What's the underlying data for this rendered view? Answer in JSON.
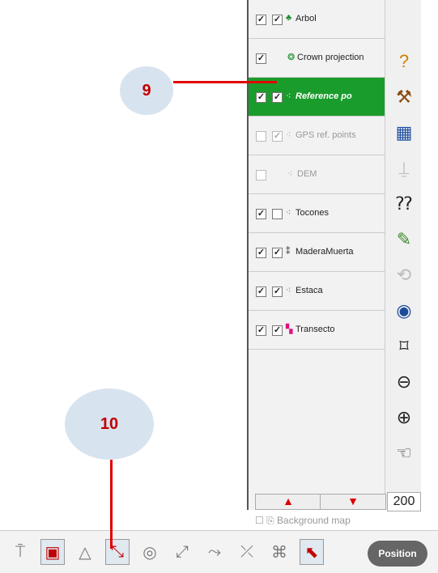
{
  "layers": [
    {
      "label": "Arbol",
      "checked1": true,
      "checked2": true,
      "icon": "tree-icon",
      "glyph": "♣",
      "color": "#1a8a2c",
      "dim": false,
      "selected": false
    },
    {
      "label": "Crown projection",
      "checked1": true,
      "checked2": null,
      "icon": "crown-icon",
      "glyph": "❂",
      "color": "#1a8a2c",
      "dim": false,
      "selected": false
    },
    {
      "label": "Reference po",
      "checked1": true,
      "checked2": true,
      "icon": "ref-points-icon",
      "glyph": "⁖",
      "color": "#ffffff",
      "dim": false,
      "selected": true
    },
    {
      "label": "GPS ref. points",
      "checked1": false,
      "checked2": true,
      "icon": "gps-points-icon",
      "glyph": "⁖",
      "color": "#aaaaaa",
      "dim": true,
      "selected": false
    },
    {
      "label": "DEM",
      "checked1": false,
      "checked2": null,
      "icon": "dem-icon",
      "glyph": "⁖",
      "color": "#aaaaaa",
      "dim": true,
      "selected": false
    },
    {
      "label": "Tocones",
      "checked1": true,
      "checked2": false,
      "icon": "stump-icon",
      "glyph": "⁖",
      "color": "#6a8a00",
      "dim": false,
      "selected": false
    },
    {
      "label": "MaderaMuerta",
      "checked1": true,
      "checked2": true,
      "icon": "deadwood-icon",
      "glyph": "⁑",
      "color": "#333333",
      "dim": false,
      "selected": false
    },
    {
      "label": "Estaca",
      "checked1": true,
      "checked2": true,
      "icon": "stake-icon",
      "glyph": "⁖",
      "color": "#6a8a00",
      "dim": false,
      "selected": false
    },
    {
      "label": "Transecto",
      "checked1": true,
      "checked2": true,
      "icon": "transect-icon",
      "glyph": "▚",
      "color": "#e01080",
      "dim": false,
      "selected": false
    }
  ],
  "right_toolbar": [
    {
      "name": "help-icon",
      "glyph": "?",
      "color": "#d08000"
    },
    {
      "name": "tools-icon",
      "glyph": "⚒",
      "color": "#8a4a10"
    },
    {
      "name": "table-icon",
      "glyph": "▦",
      "color": "#2050a0"
    },
    {
      "name": "profile-icon",
      "glyph": "⍊",
      "color": "#bbbbbb"
    },
    {
      "name": "query-icon",
      "glyph": "⁇",
      "color": "#222222"
    },
    {
      "name": "measure-icon",
      "glyph": "✎",
      "color": "#3a8a2a"
    },
    {
      "name": "rotate-icon",
      "glyph": "⟲",
      "color": "#bbbbbb"
    },
    {
      "name": "globe-icon",
      "glyph": "◉",
      "color": "#1a4a9a"
    },
    {
      "name": "zoom-extent-icon",
      "glyph": "⌑",
      "color": "#222222"
    },
    {
      "name": "zoom-out-icon",
      "glyph": "⊖",
      "color": "#222222"
    },
    {
      "name": "zoom-in-icon",
      "glyph": "⊕",
      "color": "#222222"
    },
    {
      "name": "pan-hand-icon",
      "glyph": "☜",
      "color": "#444444"
    }
  ],
  "scale_value": "200",
  "background_map_label": "Background map",
  "bottom_toolbar": [
    {
      "name": "tool-edit-icon",
      "glyph": "⍑",
      "active": false
    },
    {
      "name": "tool-select-feature-icon",
      "glyph": "▣",
      "active": true
    },
    {
      "name": "tool-polygon-icon",
      "glyph": "△",
      "active": false
    },
    {
      "name": "tool-reference-icon",
      "glyph": "⤡",
      "active": true
    },
    {
      "name": "tool-crown-icon",
      "glyph": "◎",
      "active": false
    },
    {
      "name": "tool-line-icon",
      "glyph": "⤢",
      "active": false
    },
    {
      "name": "tool-transect-icon",
      "glyph": "⤳",
      "active": false
    },
    {
      "name": "tool-cross-icon",
      "glyph": "⤫",
      "active": false
    },
    {
      "name": "tool-delete-icon",
      "glyph": "⌘",
      "active": false
    },
    {
      "name": "tool-arrow-icon",
      "glyph": "⬉",
      "active": true
    }
  ],
  "position_button_label": "Position",
  "callouts": {
    "nine": "9",
    "ten": "10"
  }
}
